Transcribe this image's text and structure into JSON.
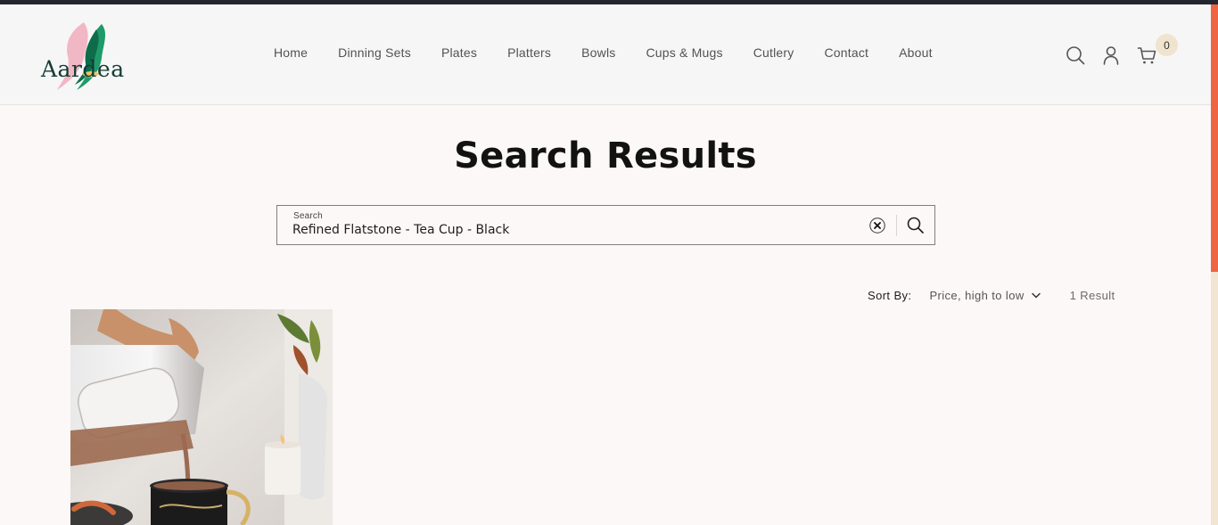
{
  "brand": {
    "logo_text": "Aardea"
  },
  "nav": {
    "items": [
      {
        "label": "Home"
      },
      {
        "label": "Dinning Sets"
      },
      {
        "label": "Plates"
      },
      {
        "label": "Platters"
      },
      {
        "label": "Bowls"
      },
      {
        "label": "Cups & Mugs"
      },
      {
        "label": "Cutlery"
      },
      {
        "label": "Contact"
      },
      {
        "label": "About"
      }
    ]
  },
  "header_icons": {
    "search": "search-icon",
    "account": "user-icon",
    "cart": "cart-icon",
    "cart_count": "0"
  },
  "page": {
    "title": "Search Results"
  },
  "search": {
    "label": "Search",
    "value": "Refined Flatstone - Tea Cup - Black"
  },
  "sort": {
    "label": "Sort By:",
    "selected": "Price, high to low",
    "result_count": "1 Result"
  },
  "colors": {
    "accent": "#ef6443",
    "badge": "#f0e4cf",
    "background": "#fcf8f7",
    "header": "#f6f6f6"
  }
}
